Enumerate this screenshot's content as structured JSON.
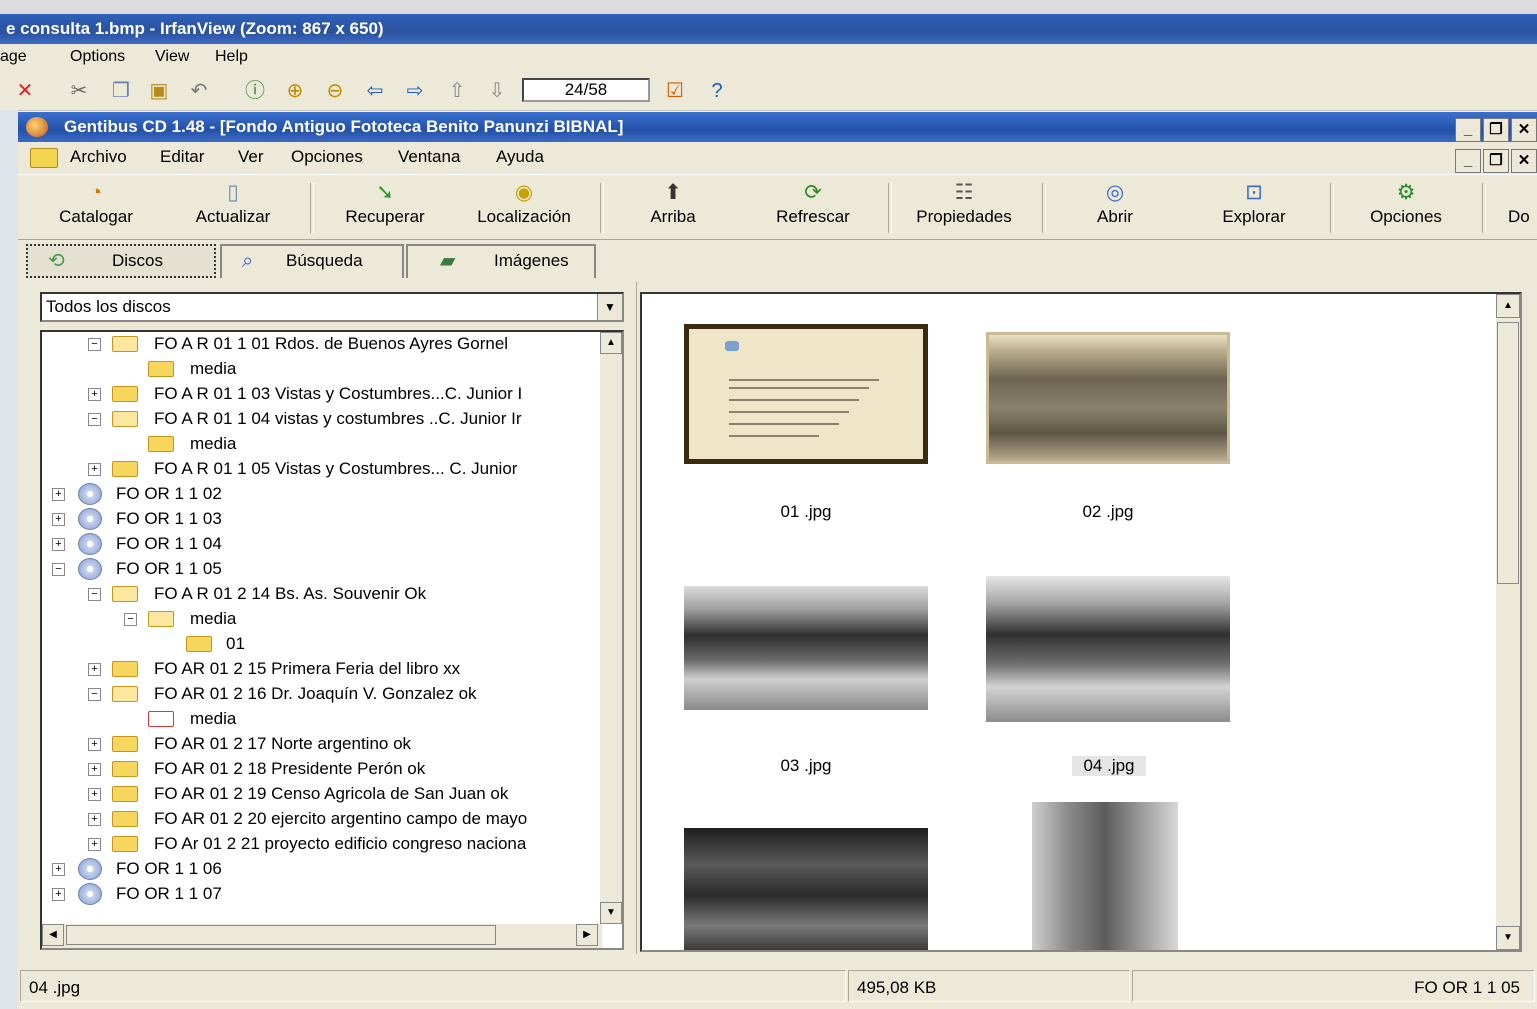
{
  "irfanview": {
    "title": "e consulta 1.bmp - IrfanView (Zoom: 867 x 650)",
    "menu": [
      "age",
      "Options",
      "View",
      "Help"
    ],
    "counter": "24/58"
  },
  "gentibus": {
    "title": "Gentibus CD 1.48 - [Fondo Antiguo Fototeca Benito Panunzi BIBNAL]",
    "menu": [
      "Archivo",
      "Editar",
      "Ver",
      "Opciones",
      "Ventana",
      "Ayuda"
    ],
    "toolbar": {
      "catalogar": "Catalogar",
      "actualizar": "Actualizar",
      "recuperar": "Recuperar",
      "localizacion": "Localización",
      "arriba": "Arriba",
      "refrescar": "Refrescar",
      "propiedades": "Propiedades",
      "abrir": "Abrir",
      "explorar": "Explorar",
      "opciones": "Opciones",
      "cut": "Do"
    },
    "tabs": {
      "discos": "Discos",
      "busqueda": "Búsqueda",
      "imagenes": "Imágenes"
    },
    "disk_select": "Todos los discos",
    "tree": [
      "FO A R 01  1 01  Rdos. de Buenos Ayres Gornel",
      "media",
      "FO A R 01  1 03 Vistas y Costumbres...C. Junior I",
      "FO A R 01  1 04 vistas y costumbres ..C. Junior Ir",
      "media",
      "FO A R 01  1 05 Vistas y Costumbres... C. Junior",
      "FO OR 1 1 02",
      "FO OR 1 1 03",
      "FO OR 1 1 04",
      "FO OR 1 1 05",
      "FO A R 01 2 14 Bs. As. Souvenir Ok",
      "media",
      "01",
      "FO AR 01 2 15 Primera Feria del libro xx",
      "FO AR 01 2 16 Dr. Joaquín V. Gonzalez ok",
      "media",
      "FO AR 01 2 17 Norte argentino ok",
      "FO AR 01 2 18 Presidente Perón ok",
      "FO AR 01 2 19 Censo Agricola de San Juan ok",
      "FO AR 01 2 20 ejercito argentino campo de mayo",
      "FO Ar 01  2 21  proyecto edificio congreso naciona",
      "FO OR 1 1 06",
      "FO OR 1 1 07"
    ],
    "thumbnails": [
      "01 .jpg",
      "02 .jpg",
      "03 .jpg",
      "04 .jpg"
    ],
    "status": {
      "file": "04 .jpg",
      "size": "495,08 KB",
      "disk": "FO OR 1 1 05"
    }
  }
}
